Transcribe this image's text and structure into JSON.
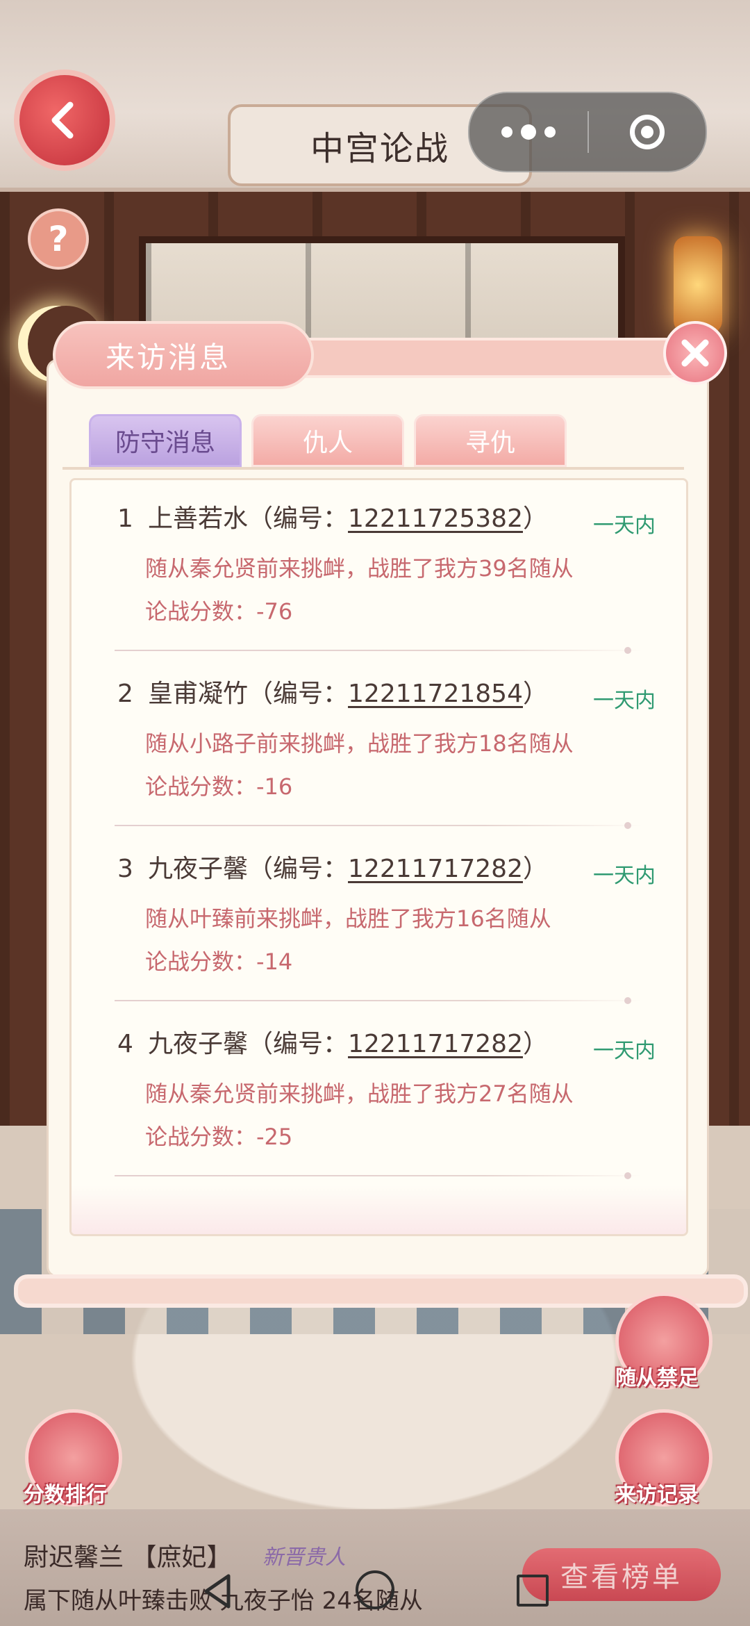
{
  "header": {
    "title": "中宫论战"
  },
  "panel": {
    "title": "来访消息",
    "tabs": [
      "防守消息",
      "仇人",
      "寻仇"
    ],
    "entries": [
      {
        "index": "1",
        "name": "上善若水",
        "code_prefix": "（编号：",
        "code": "12211725382",
        "code_suffix": "）",
        "time": "一天内",
        "desc": "随从秦允贤前来挑衅，战胜了我方39名随从",
        "score": "论战分数：-76"
      },
      {
        "index": "2",
        "name": "皇甫凝竹",
        "code_prefix": "（编号：",
        "code": "12211721854",
        "code_suffix": "）",
        "time": "一天内",
        "desc": "随从小路子前来挑衅，战胜了我方18名随从",
        "score": "论战分数：-16"
      },
      {
        "index": "3",
        "name": "九夜子馨",
        "code_prefix": "（编号：",
        "code": "12211717282",
        "code_suffix": "）",
        "time": "一天内",
        "desc": "随从叶臻前来挑衅，战胜了我方16名随从",
        "score": "论战分数：-14"
      },
      {
        "index": "4",
        "name": "九夜子馨",
        "code_prefix": "（编号：",
        "code": "12211717282",
        "code_suffix": "）",
        "time": "一天内",
        "desc": "随从秦允贤前来挑衅，战胜了我方27名随从",
        "score": "论战分数：-25"
      }
    ]
  },
  "side": {
    "ban_label": "随从禁足",
    "rank_label": "分数排行",
    "records_label": "来访记录"
  },
  "bottom": {
    "name": "尉迟馨兰 【庶妃】",
    "logo": "新晋贵人",
    "line2": "属下随从叶臻击败 九夜子怡 24名随从",
    "rank_button": "查看榜单"
  }
}
